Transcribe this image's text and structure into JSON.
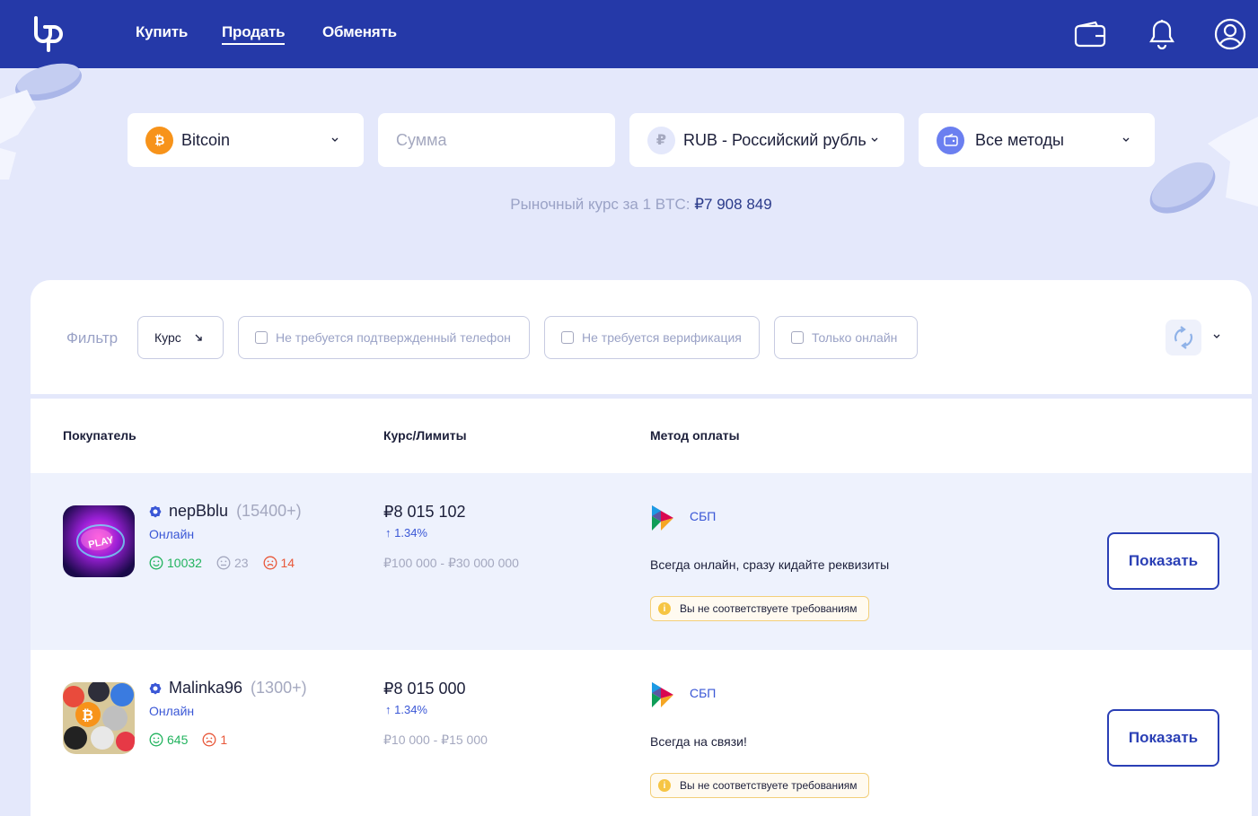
{
  "header": {
    "nav": [
      {
        "label": "Купить",
        "active": false
      },
      {
        "label": "Продать",
        "active": true
      },
      {
        "label": "Обменять",
        "active": false
      }
    ],
    "icons": [
      "wallet-icon",
      "bell-icon",
      "user-icon"
    ]
  },
  "search": {
    "crypto": {
      "label": "Bitcoin",
      "icon": "bitcoin-icon",
      "color": "#f7931a"
    },
    "amount_placeholder": "Сумма",
    "currency": {
      "label": "RUB - Российский рубль",
      "icon": "ruble-icon"
    },
    "method": {
      "label": "Все методы",
      "icon": "methods-icon"
    }
  },
  "market": {
    "label": "Рыночный курс за 1 BTC:",
    "value": "₽7 908 849"
  },
  "filter": {
    "label": "Фильтр",
    "sort": "Курс",
    "checkboxes": [
      "Не требуется подтвержденный телефон",
      "Не требуется верификация",
      "Только онлайн"
    ]
  },
  "table": {
    "headers": [
      "Покупатель",
      "Курс/Лимиты",
      "Метод оплаты"
    ],
    "rows": [
      {
        "name": "nepBblu",
        "count": "(15400+)",
        "status": "Онлайн",
        "positive": "10032",
        "neutral": "23",
        "negative": "14",
        "price": "₽8 015 102",
        "pct": "1.34%",
        "limits": "₽100 000 - ₽30 000 000",
        "method": "СБП",
        "desc": "Всегда онлайн, сразу кидайте реквизиты",
        "warning": "Вы не соответствуете требованиям",
        "button": "Показать"
      },
      {
        "name": "Malinka96",
        "count": "(1300+)",
        "status": "Онлайн",
        "positive": "645",
        "negative": "1",
        "price": "₽8 015 000",
        "pct": "1.34%",
        "limits": "₽10 000 - ₽15 000",
        "method": "СБП",
        "desc": "Всегда на связи!",
        "warning": "Вы не соответствуете требованиям",
        "button": "Показать"
      }
    ]
  },
  "colors": {
    "header": "#2539a8",
    "accent": "#3a57d6",
    "positive": "#22b35e",
    "negative": "#e8583a",
    "neutral": "#a4a8bf"
  }
}
